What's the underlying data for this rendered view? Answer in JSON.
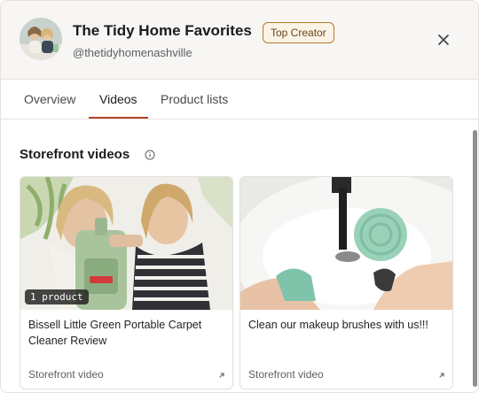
{
  "header": {
    "title": "The Tidy Home Favorites",
    "badge": "Top Creator",
    "handle": "@thetidyhomenashville",
    "close_icon": "close-icon"
  },
  "tabs": [
    {
      "label": "Overview",
      "active": false
    },
    {
      "label": "Videos",
      "active": true
    },
    {
      "label": "Product lists",
      "active": false
    }
  ],
  "section": {
    "title": "Storefront videos",
    "info_icon": "info-icon"
  },
  "videos": [
    {
      "title": "Bissell Little Green Portable Carpet Cleaner Review",
      "meta": "Storefront video",
      "badge": "1 product",
      "icon": "external-arrow-icon"
    },
    {
      "title": "Clean our makeup brushes with us!!!",
      "meta": "Storefront video",
      "icon": "external-arrow-icon"
    }
  ],
  "colors": {
    "accent_underline": "#b4432a",
    "badge_border": "#b47a2b",
    "header_bg": "#f7f6f4"
  }
}
